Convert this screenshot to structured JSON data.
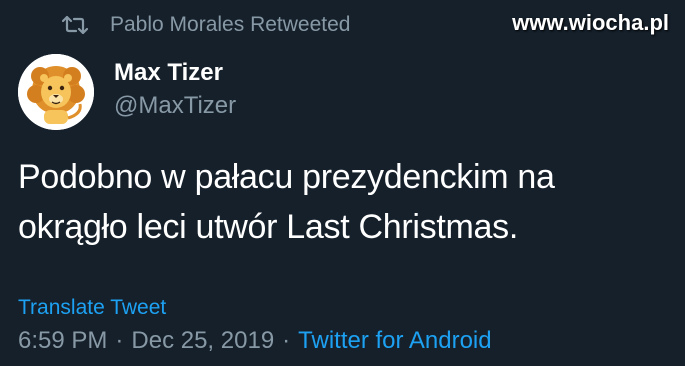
{
  "retweet": {
    "label": "Pablo Morales Retweeted",
    "icon": "retweet-icon"
  },
  "watermark": {
    "text": "www.wiocha.pl"
  },
  "author": {
    "name": "Max Tizer",
    "handle": "@MaxTizer",
    "avatar_icon": "lion-avatar-icon"
  },
  "tweet": {
    "line1": "Podobno w pałacu prezydenckim na",
    "line2": "okrągło leci utwór Last Christmas."
  },
  "translate_label": "Translate Tweet",
  "meta": {
    "time": "6:59 PM",
    "separator": "·",
    "date": "Dec 25, 2019",
    "source": "Twitter for Android"
  },
  "colors": {
    "background": "#15202b",
    "primary_text": "#ffffff",
    "secondary_text": "#8899a6",
    "link": "#1da1f2"
  }
}
